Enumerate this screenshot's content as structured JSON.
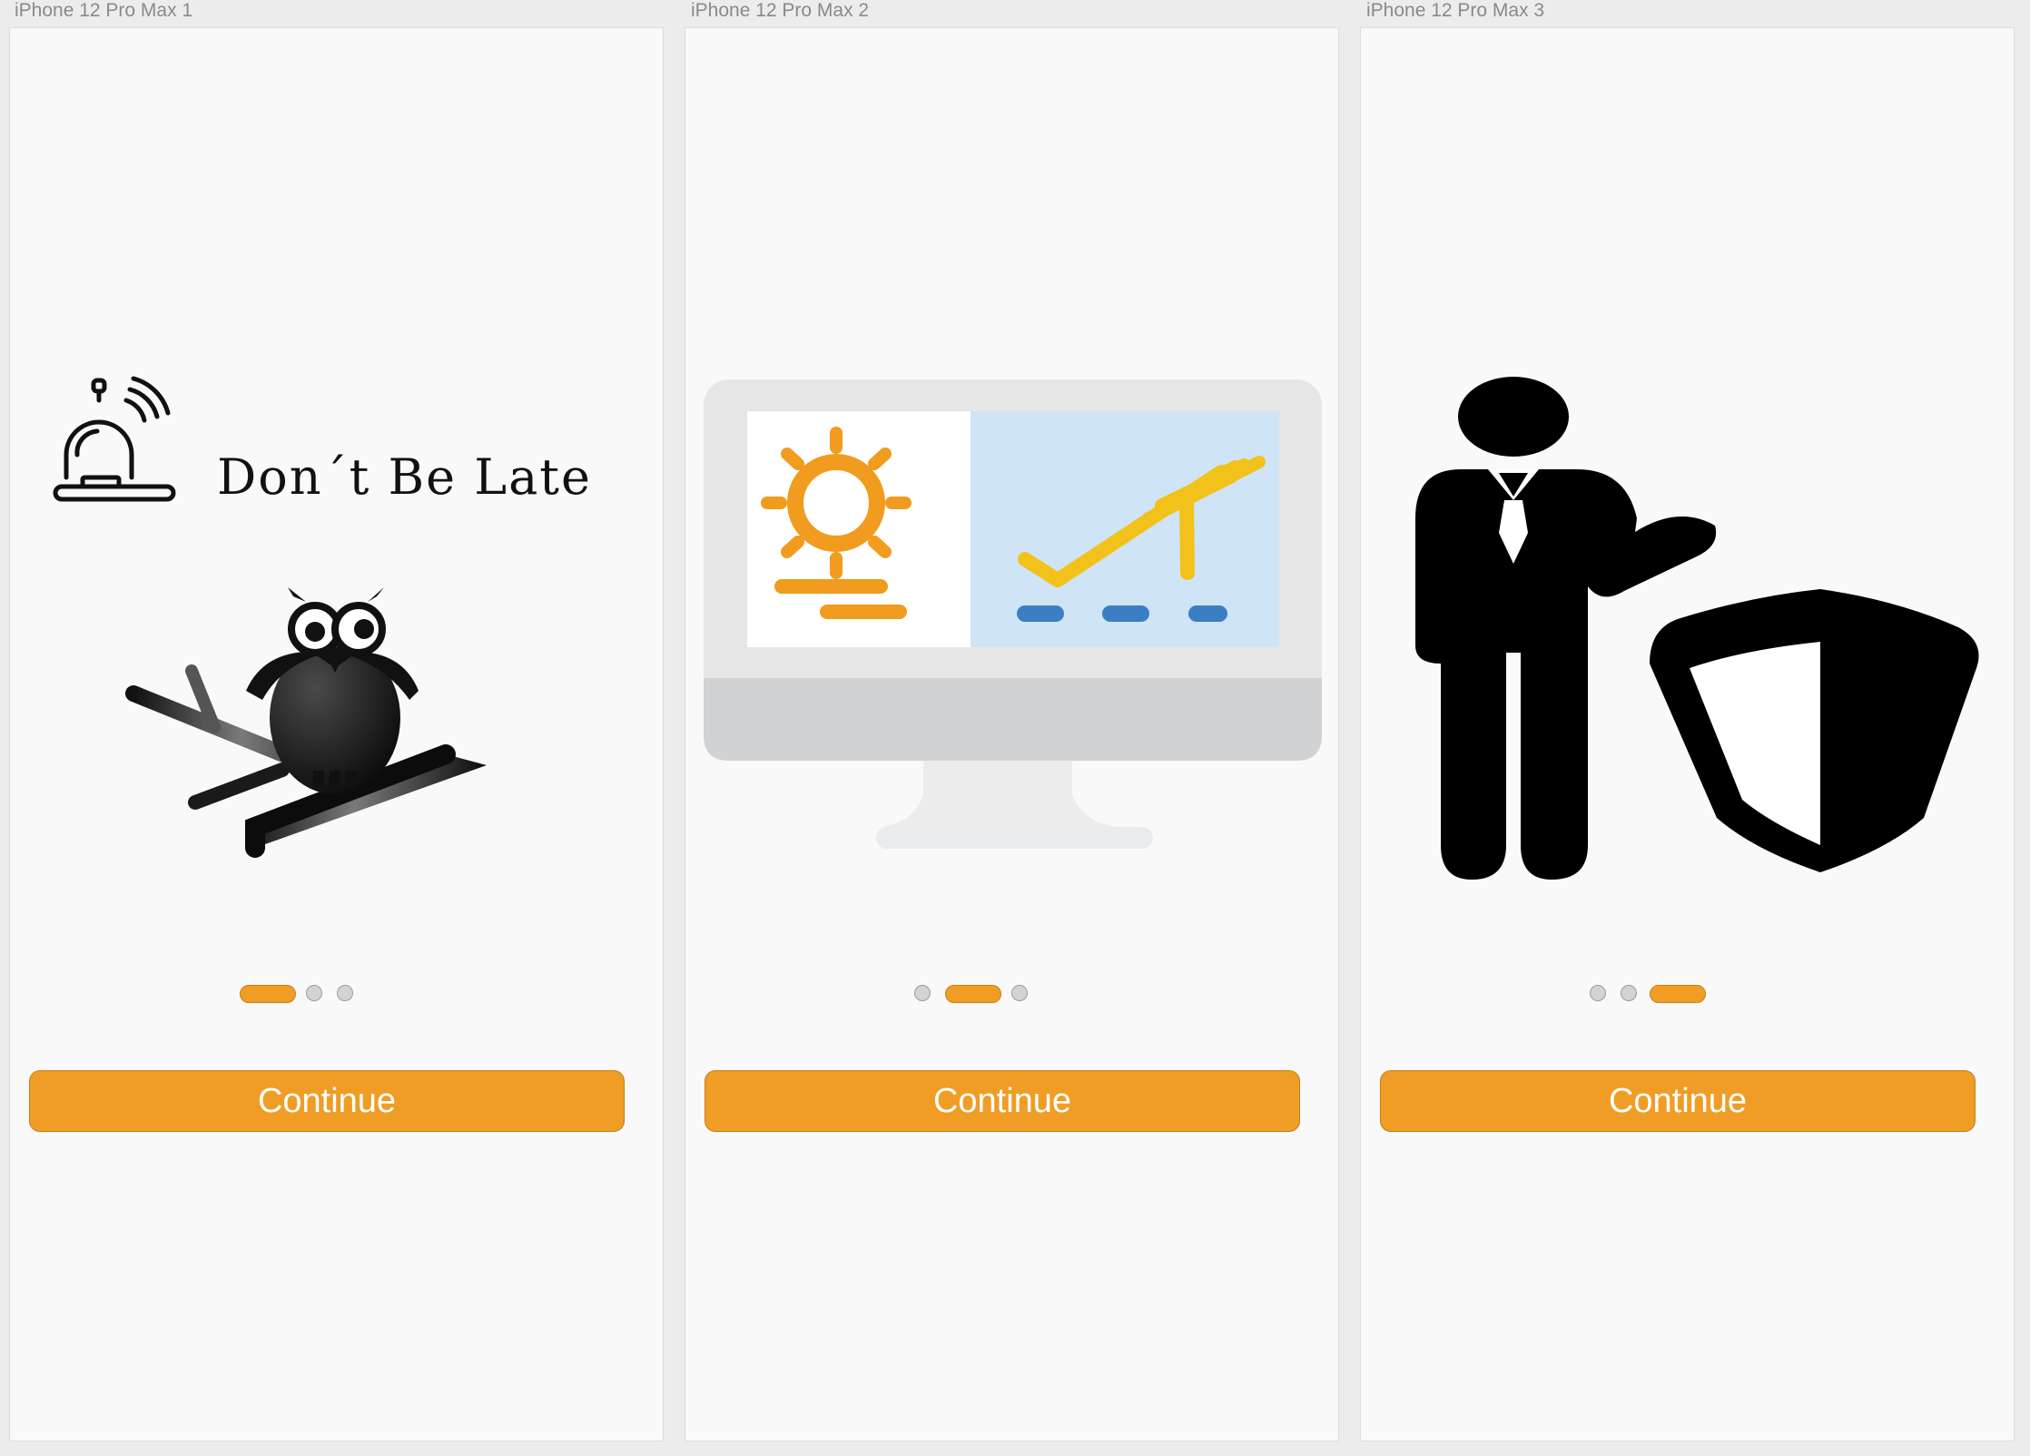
{
  "artboards": [
    {
      "title": "iPhone 12 Pro Max 1",
      "logo_text": "Don´t Be Late",
      "illustration": "owl-on-branch-icon",
      "active_page": 1,
      "page_count": 3,
      "button_label": "Continue"
    },
    {
      "title": "iPhone 12 Pro Max 2",
      "illustration": "monitor-weather-flight-icon",
      "active_page": 2,
      "page_count": 3,
      "button_label": "Continue"
    },
    {
      "title": "iPhone 12 Pro Max 3",
      "illustration": "businessman-shield-icon",
      "active_page": 3,
      "page_count": 3,
      "button_label": "Continue"
    }
  ],
  "colors": {
    "accent": "#f09d25",
    "artboard_bg": "#f9f9f9",
    "canvas_bg": "#ececec",
    "dot_inactive": "#d3d3d3",
    "weather_sun": "#f19b1f",
    "flight_yellow": "#f2c21b",
    "screen_blue": "#cfe4f7",
    "dash_blue": "#3c7ec4"
  }
}
